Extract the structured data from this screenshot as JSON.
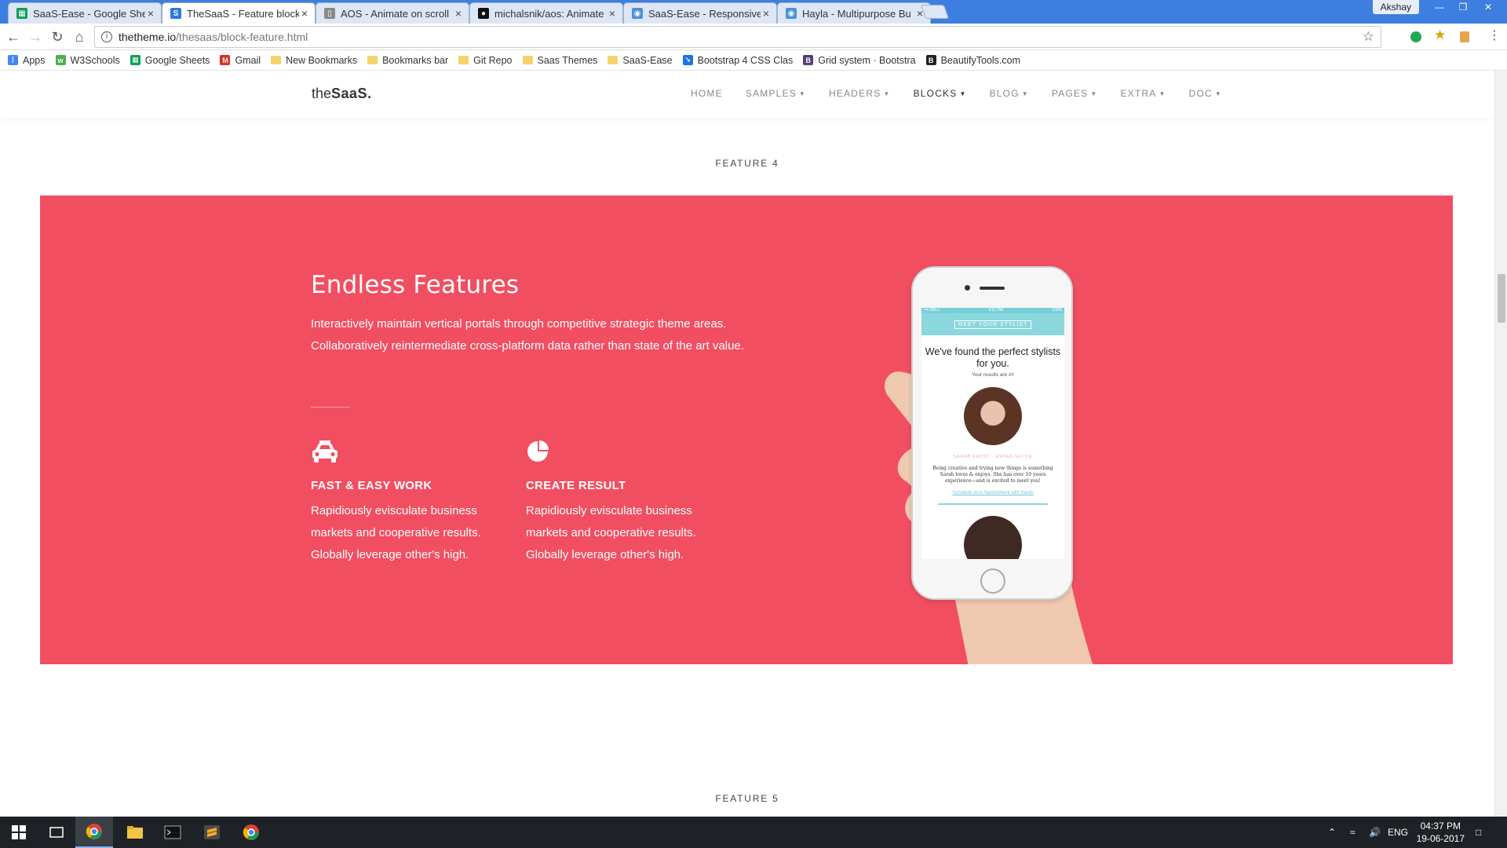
{
  "browser": {
    "tabs": [
      {
        "title": "SaaS-Ease - Google Shee",
        "favicon": "sheets-icon",
        "color": "#0f9d58",
        "active": false
      },
      {
        "title": "TheSaaS - Feature blocks",
        "favicon": "s-icon",
        "color": "#2a7ae2",
        "active": true
      },
      {
        "title": "AOS - Animate on scroll",
        "favicon": "page-icon",
        "color": "#888888",
        "active": false
      },
      {
        "title": "michalsnik/aos: Animate",
        "favicon": "github-icon",
        "color": "#111111",
        "active": false
      },
      {
        "title": "SaaS-Ease - Responsive",
        "favicon": "globe-icon",
        "color": "#4a90d9",
        "active": false
      },
      {
        "title": "Hayla - Multipurpose Bu",
        "favicon": "globe-icon",
        "color": "#4a90d9",
        "active": false
      }
    ],
    "user": "Akshay",
    "url_host": "thetheme.io",
    "url_path": "/thesaas/block-feature.html",
    "bookmarks": [
      {
        "label": "Apps",
        "icon": "apps-icon"
      },
      {
        "label": "W3Schools",
        "icon": "w3schools-icon"
      },
      {
        "label": "Google Sheets",
        "icon": "sheets-icon"
      },
      {
        "label": "Gmail",
        "icon": "gmail-icon"
      },
      {
        "label": "New Bookmarks",
        "icon": "folder-icon"
      },
      {
        "label": "Bookmarks bar",
        "icon": "folder-icon"
      },
      {
        "label": "Git Repo",
        "icon": "folder-icon"
      },
      {
        "label": "Saas Themes",
        "icon": "folder-icon"
      },
      {
        "label": "SaaS-Ease",
        "icon": "folder-icon"
      },
      {
        "label": "Bootstrap 4 CSS Clas",
        "icon": "bootstrap-icon"
      },
      {
        "label": "Grid system · Bootstra",
        "icon": "b-icon"
      },
      {
        "label": "BeautifyTools.com",
        "icon": "bt-icon"
      }
    ]
  },
  "site": {
    "logo_light": "the",
    "logo_bold": "SaaS.",
    "menu": [
      {
        "label": "HOME",
        "caret": false,
        "active": false
      },
      {
        "label": "SAMPLES",
        "caret": true,
        "active": false
      },
      {
        "label": "HEADERS",
        "caret": true,
        "active": false
      },
      {
        "label": "BLOCKS",
        "caret": true,
        "active": true
      },
      {
        "label": "BLOG",
        "caret": true,
        "active": false
      },
      {
        "label": "PAGES",
        "caret": true,
        "active": false
      },
      {
        "label": "EXTRA",
        "caret": true,
        "active": false
      },
      {
        "label": "DOC",
        "caret": true,
        "active": false
      }
    ]
  },
  "section4": {
    "label": "FEATURE 4",
    "bg_color": "#f24e61",
    "title": "Endless Features",
    "description": "Interactively maintain vertical portals through competitive strategic theme areas. Collaboratively reintermediate cross-platform data rather than state of the art value.",
    "features": [
      {
        "icon": "taxi-icon",
        "title": "FAST & EASY WORK",
        "text": "Rapidiously evisculate business markets and cooperative results. Globally leverage other's high."
      },
      {
        "icon": "pie-chart-icon",
        "title": "CREATE RESULT",
        "text": "Rapidiously evisculate business markets and cooperative results. Globally leverage other's high."
      }
    ],
    "phone": {
      "status_left": "•••• BELL",
      "status_mid": "4:21 PM",
      "status_right": "100%",
      "header": "MEET YOUR STYLIST",
      "heading": "We've found the perfect stylists for you.",
      "subheading": "Your results are in!",
      "names": "SARAH FROST · ASHAD SALON",
      "bio": "Being creative and trying new things is something Sarah loves & enjoys. She has over 10 years experience—and is excited to meet you!",
      "link": "Schedule your Appointment with Sarah"
    }
  },
  "section5": {
    "label": "FEATURE 5"
  },
  "taskbar": {
    "language": "ENG",
    "time": "04:37 PM",
    "date": "19-06-2017"
  }
}
